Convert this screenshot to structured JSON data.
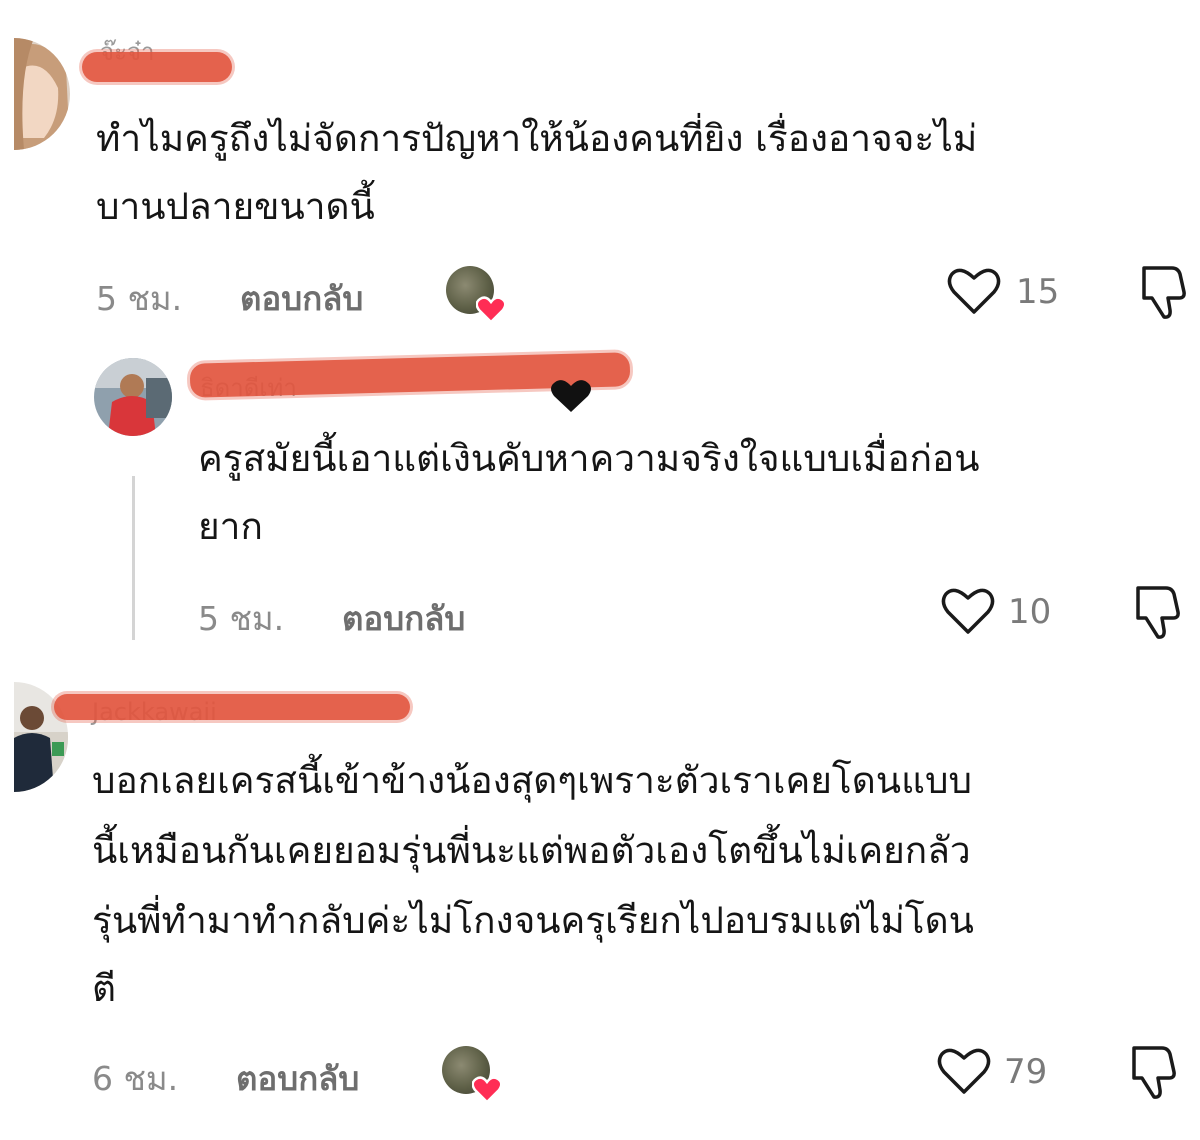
{
  "comments": [
    {
      "username": "จ๊ะจ๋า",
      "text": "ทำไมครูถึงไม่จัดการปัญหาให้น้องคนที่ยิง เรื่องอาจจะไม่บานปลายขนาดนี้",
      "line1": "ทำไมครูถึงไม่จัดการปัญหาให้น้องคนที่ยิง เรื่องอาจจะไม่",
      "line2": "บานปลายขนาดนี้",
      "time": "5 ชม.",
      "reply_label": "ตอบกลับ",
      "likes": "15",
      "creator_liked": true
    },
    {
      "username": "ธิดาดีเท่า",
      "text": "ครูสมัยนี้เอาแต่เงินคับหาความจริงใจแบบเมื่อก่อนยาก",
      "line1": "ครูสมัยนี้เอาแต่เงินคับหาความจริงใจแบบเมื่อก่อน",
      "line2": "ยาก",
      "time": "5 ชม.",
      "reply_label": "ตอบกลับ",
      "likes": "10",
      "is_reply": true
    },
    {
      "username": "Jackkawaii",
      "text": "บอกเลยเครสนี้เข้าข้างน้องสุดๆเพราะตัวเราเคยโดนแบบนี้เหมือนกันเคยยอมรุ่นพี่นะแต่พอตัวเองโตขึ้นไม่เคยกลัวรุ่นพี่ทำมาทำกลับค่ะไม่โกงจนครุเรียกไปอบรมแต่ไม่โดนตี",
      "line1": "บอกเลยเครสนี้เข้าข้างน้องสุดๆเพราะตัวเราเคยโดนแบบ",
      "line2": "นี้เหมือนกันเคยยอมรุ่นพี่นะแต่พอตัวเองโตขึ้นไม่เคยกลัว",
      "line3": "รุ่นพี่ทำมาทำกลับค่ะไม่โกงจนครุเรียกไปอบรมแต่ไม่โดน",
      "line4": "ตี",
      "time": "6 ชม.",
      "reply_label": "ตอบกลับ",
      "likes": "79",
      "creator_liked": true
    }
  ],
  "icons": {
    "like": "heart-outline-icon",
    "dislike": "thumbs-down-outline-icon",
    "creator_like": "creator-heart-badge-icon"
  },
  "colors": {
    "redaction": "#e2553e",
    "badge_heart": "#ff2d55",
    "muted_text": "#8a8a8a"
  }
}
